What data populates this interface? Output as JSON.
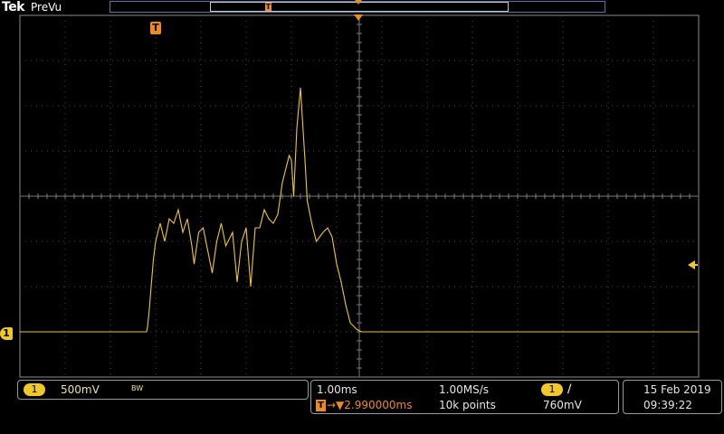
{
  "header": {
    "brand": "Tek",
    "mode": "PreVu",
    "record_trigger_label": "T"
  },
  "screen": {
    "trigger_marker_label": "T",
    "channel_marker_label": "1"
  },
  "colors": {
    "trace": "#f0c828",
    "trigger": "#f08a1c",
    "grid": "#4a4a4a",
    "frame": "#8c8c8c"
  },
  "channel_panel": {
    "channel": "1",
    "scale": "500mV",
    "bandwidth_flag": "BW"
  },
  "acquisition_panel": {
    "timebase": "1.00ms",
    "sample_rate": "1.00MS/s",
    "trigger_source": "1",
    "trigger_slope": "∕",
    "trigger_box": "T",
    "trigger_delay": "→▼2.990000ms",
    "record_length": "10k points",
    "trigger_level": "760mV"
  },
  "datetime": {
    "date": "15 Feb  2019",
    "time": "09:39:22"
  },
  "chart_data": {
    "type": "line",
    "x_divisions": 15,
    "y_divisions": 8,
    "time_per_div_ms": 1.0,
    "volts_per_div_mV": 500,
    "series": [
      {
        "channel": "1",
        "x_div": [
          0,
          2.8,
          2.82,
          2.86,
          2.9,
          2.95,
          3.0,
          3.05,
          3.1,
          3.2,
          3.3,
          3.4,
          3.5,
          3.6,
          3.7,
          3.8,
          3.85,
          3.95,
          4.05,
          4.15,
          4.25,
          4.35,
          4.45,
          4.55,
          4.7,
          4.8,
          4.9,
          5.0,
          5.1,
          5.2,
          5.3,
          5.4,
          5.5,
          5.6,
          5.7,
          5.8,
          5.9,
          5.95,
          6.0,
          6.05,
          6.12,
          6.2,
          6.3,
          6.35,
          6.45,
          6.55,
          6.7,
          6.8,
          6.9,
          6.95,
          7.0,
          7.1,
          7.2,
          7.3,
          7.45,
          7.55,
          7.65,
          7.8,
          8.0,
          15
        ],
        "y_div": [
          0,
          0,
          0.1,
          0.5,
          1.0,
          1.6,
          2.0,
          2.2,
          2.4,
          2.0,
          2.5,
          2.4,
          2.7,
          2.2,
          2.5,
          1.9,
          1.5,
          2.2,
          2.3,
          1.8,
          1.3,
          2.0,
          2.4,
          1.9,
          2.2,
          1.1,
          2.0,
          2.3,
          1.0,
          2.3,
          2.3,
          2.7,
          2.5,
          2.4,
          2.6,
          3.3,
          3.7,
          3.9,
          3.8,
          3.0,
          4.5,
          5.4,
          3.8,
          2.9,
          2.4,
          2.0,
          2.2,
          2.3,
          2.1,
          1.8,
          1.5,
          1.1,
          0.6,
          0.2,
          0.05,
          0,
          0,
          0,
          0,
          0
        ]
      }
    ]
  }
}
